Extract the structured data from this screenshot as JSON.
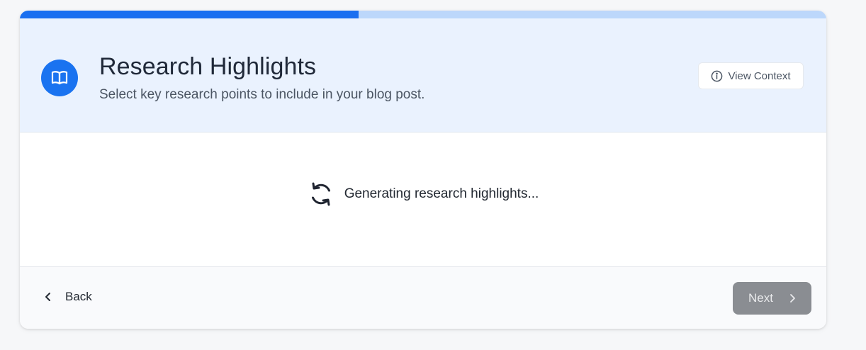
{
  "progress": {
    "value_percent": 42,
    "fill_color": "#1a6ff0",
    "track_color": "#bcd7fb"
  },
  "header": {
    "icon": "book-open-icon",
    "title": "Research Highlights",
    "subtitle": "Select key research points to include in your blog post.",
    "view_context": {
      "icon": "info-icon",
      "label": "View Context"
    }
  },
  "loading": {
    "icon": "refresh-icon",
    "text": "Generating research highlights..."
  },
  "footer": {
    "back": {
      "icon": "chevron-left-icon",
      "label": "Back"
    },
    "next": {
      "icon": "chevron-right-icon",
      "label": "Next",
      "state": "disabled"
    }
  },
  "colors": {
    "accent": "#1a73f0",
    "header_bg": "#eaf2fe",
    "next_bg": "#8a8d92"
  }
}
